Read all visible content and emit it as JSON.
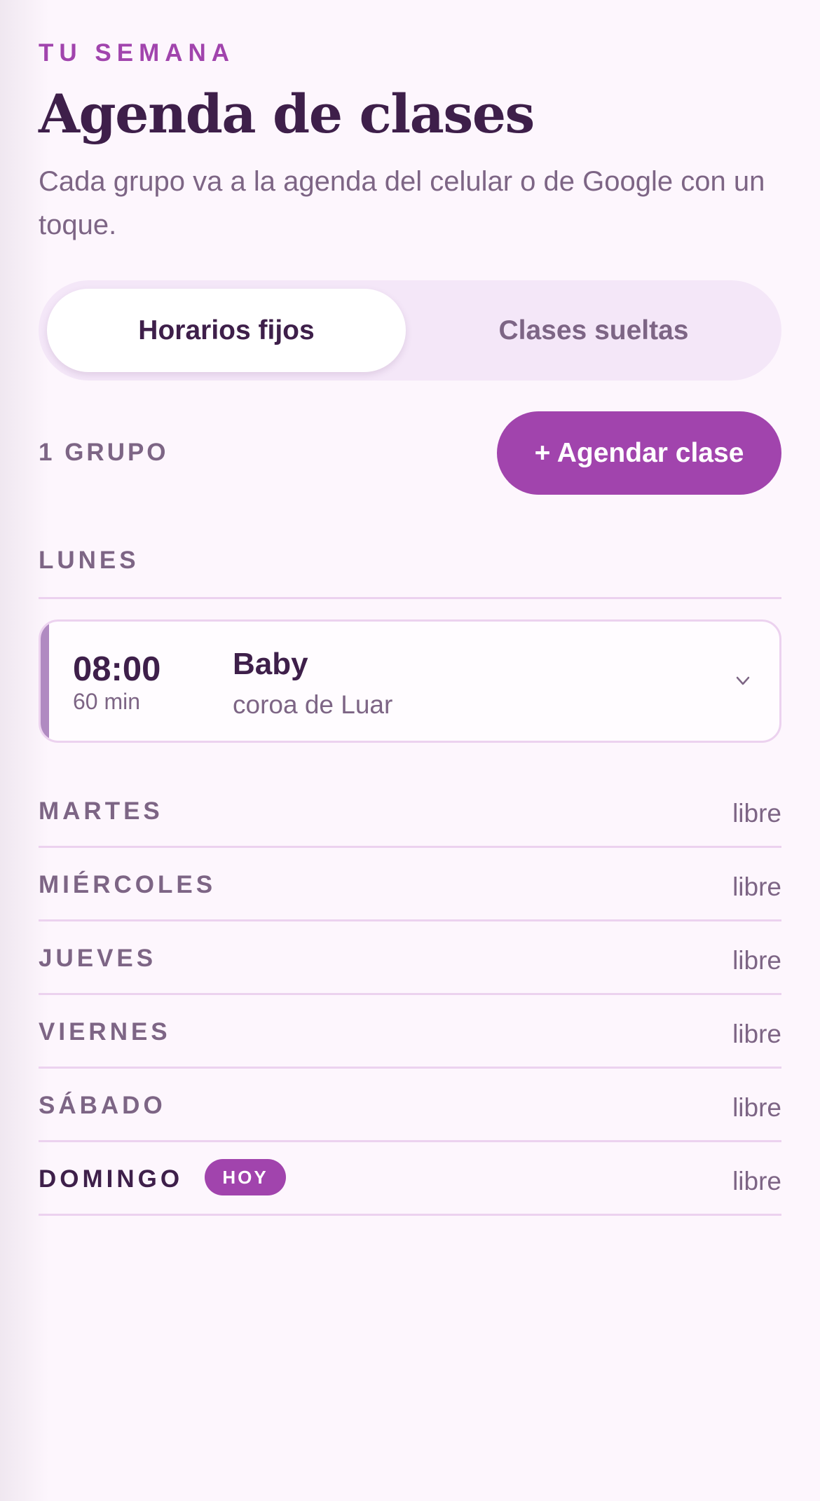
{
  "header": {
    "eyebrow": "TU SEMANA",
    "title": "Agenda de clases",
    "subtitle": "Cada grupo va a la agenda del celular o de Google con un toque."
  },
  "tabs": [
    {
      "label": "Horarios fijos",
      "active": true
    },
    {
      "label": "Clases sueltas",
      "active": false
    }
  ],
  "toolbar": {
    "group_count": "1 GRUPO",
    "add_label": "+ Agendar clase"
  },
  "days": [
    {
      "name": "LUNES",
      "classes": [
        {
          "time": "08:00",
          "duration": "60 min",
          "name": "Baby",
          "subtitle": "coroa de Luar",
          "icon": "chevron-down-icon"
        }
      ]
    },
    {
      "name": "MARTES",
      "status": "libre"
    },
    {
      "name": "MIÉRCOLES",
      "status": "libre"
    },
    {
      "name": "JUEVES",
      "status": "libre"
    },
    {
      "name": "VIERNES",
      "status": "libre"
    },
    {
      "name": "SÁBADO",
      "status": "libre"
    },
    {
      "name": "DOMINGO",
      "status": "libre",
      "badge": "HOY"
    }
  ],
  "colors": {
    "accent": "#a144ad",
    "text_primary": "#3e1f4a",
    "text_muted": "#7d6585",
    "background": "#fdf6fd",
    "divider": "#ecd2ef"
  }
}
